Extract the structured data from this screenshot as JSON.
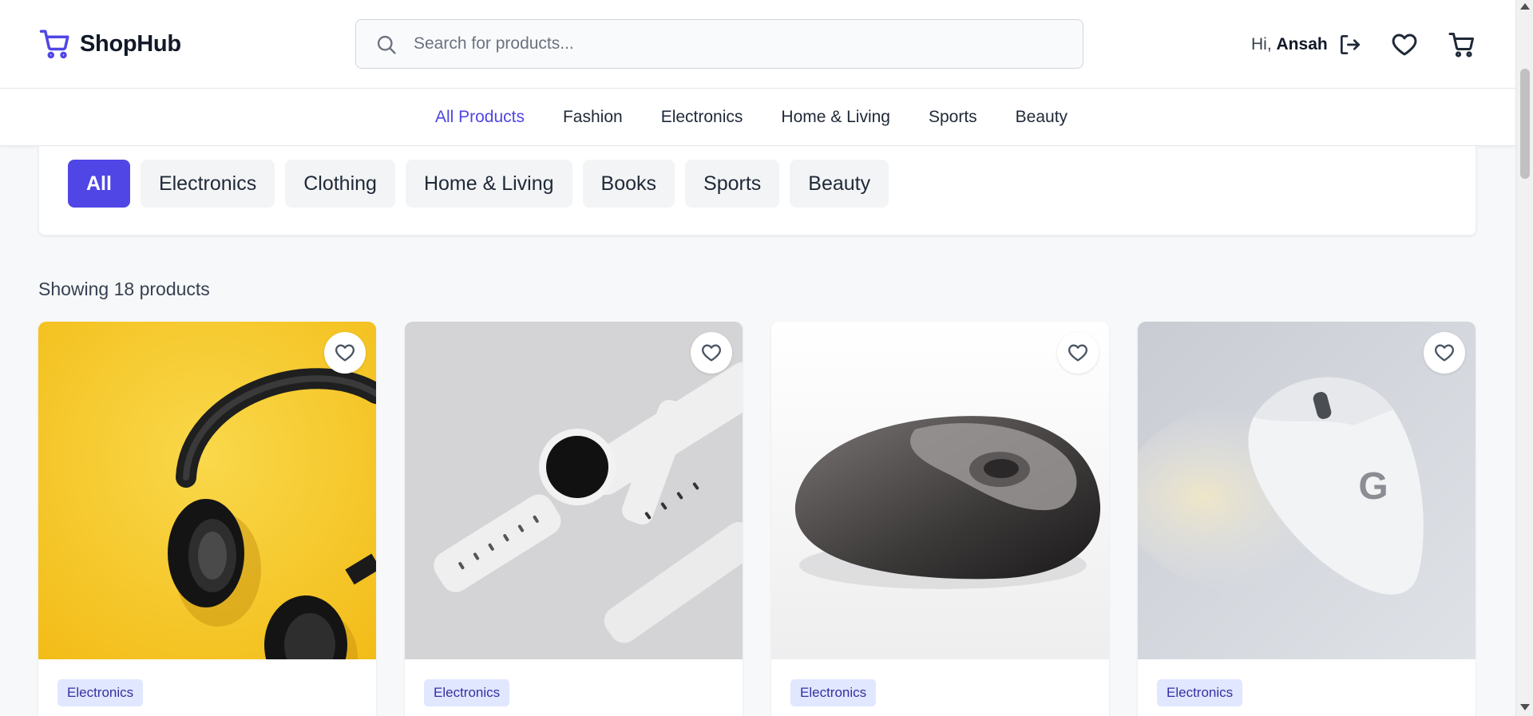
{
  "header": {
    "brand": "ShopHub",
    "search_placeholder": "Search for products...",
    "greeting": "Hi,",
    "user_name": "Ansah",
    "icons": [
      "cart-logo-icon",
      "search-icon",
      "logout-icon",
      "heart-icon",
      "cart-icon"
    ]
  },
  "nav": {
    "items": [
      "All Products",
      "Fashion",
      "Electronics",
      "Home & Living",
      "Sports",
      "Beauty"
    ],
    "active": "All Products"
  },
  "filters": {
    "chips": [
      "All",
      "Electronics",
      "Clothing",
      "Home & Living",
      "Books",
      "Sports",
      "Beauty"
    ],
    "active": "All"
  },
  "results": {
    "count_text": "Showing 18 products"
  },
  "products": [
    {
      "category": "Electronics",
      "image": "headphones-on-yellow"
    },
    {
      "category": "Electronics",
      "image": "white-smartwatch"
    },
    {
      "category": "Electronics",
      "image": "black-wireless-mouse"
    },
    {
      "category": "Electronics",
      "image": "white-gaming-mouse"
    }
  ],
  "colors": {
    "accent": "#4f46e5",
    "badge_bg": "#e0e7ff",
    "badge_text": "#3730a3",
    "chip_bg": "#f3f4f6",
    "page_bg": "#f7f8fa"
  }
}
